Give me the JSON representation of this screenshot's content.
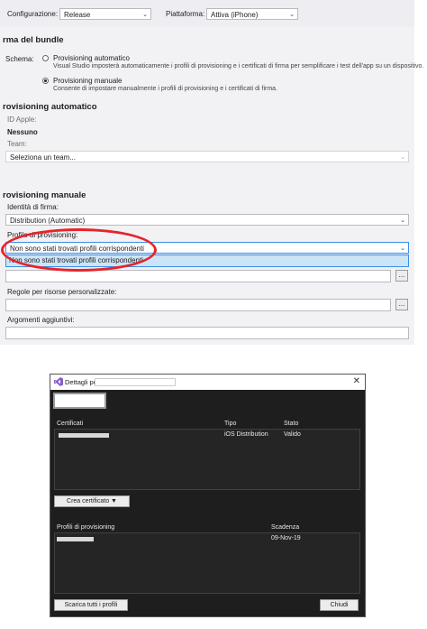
{
  "toolbar": {
    "config_label": "Configurazione:",
    "config_value": "Release",
    "platform_label": "Piattaforma:",
    "platform_value": "Attiva (iPhone)"
  },
  "bundle_signing": {
    "title": "rma del bundle",
    "scheme_label": "Schema:",
    "auto_option": "Provisioning automatico",
    "auto_desc": "Visual Studio imposterà automaticamente i profili di provisioning e i certificati di firma per semplificare i test dell'app su un dispositivo.",
    "manual_option": "Provisioning manuale",
    "manual_desc": "Consente di impostare manualmente i profili di provisioning e i certificati di firma.",
    "selected": "manual"
  },
  "auto_provisioning": {
    "title": "rovisioning automatico",
    "apple_id_label": "ID Apple:",
    "apple_id_value": "Nessuno",
    "team_label": "Team:",
    "team_value": "Seleziona un team..."
  },
  "manual_provisioning": {
    "title": "rovisioning manuale",
    "identity_label": "Identità di firma:",
    "identity_value": "Distribution (Automatic)",
    "profile_label": "Profilo di provisioning:",
    "profile_value": "Non sono stati trovati profili corrispondenti",
    "dropdown_option": "Non sono stati trovati profili corrispondenti",
    "custom_rules_label": "Regole per risorse personalizzate:",
    "extra_args_label": "Argomenti aggiuntivi:",
    "browse_label": "..."
  },
  "dialog": {
    "title": "Dettagli per",
    "close": "✕",
    "certs_headers": [
      "Certificati",
      "Tipo",
      "Stato"
    ],
    "cert_row": {
      "type": "iOS Distribution",
      "status": "Valido"
    },
    "create_cert_button": "Crea certificato ▼",
    "profiles_headers": [
      "Profili di provisioning",
      "Scadenza"
    ],
    "profile_row": {
      "expiry": "09-Nov-19"
    },
    "download_all_button": "Scarica tutti i profili",
    "close_button": "Chiudi"
  },
  "colors": {
    "highlight_ring": "#e8232a",
    "dropdown_selection": "#cce4f7",
    "dialog_bg": "#1e1e1e",
    "vs_purple": "#865fc5"
  }
}
